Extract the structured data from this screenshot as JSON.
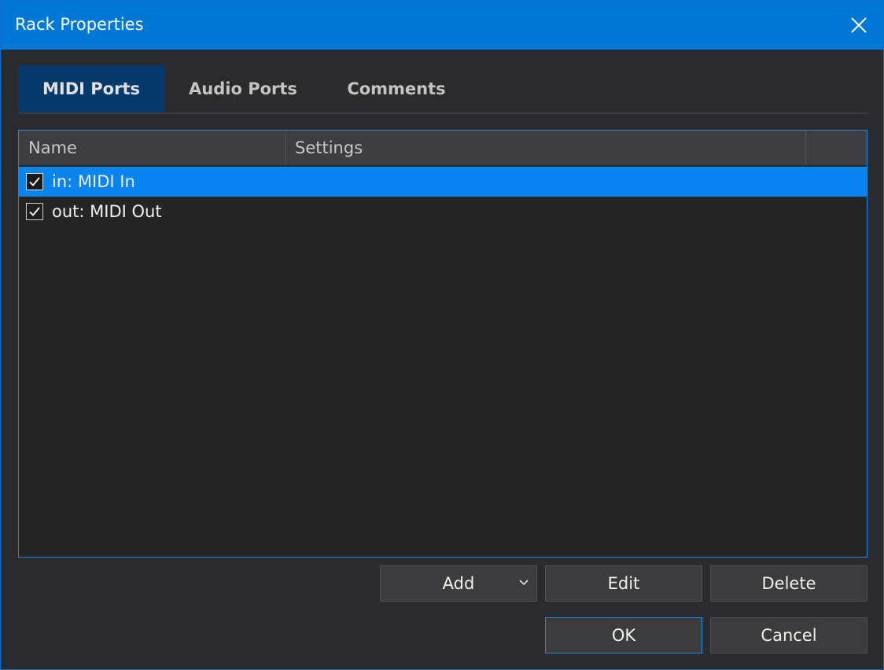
{
  "window": {
    "title": "Rack Properties"
  },
  "tabs": [
    {
      "label": "MIDI Ports",
      "active": true
    },
    {
      "label": "Audio Ports",
      "active": false
    },
    {
      "label": "Comments",
      "active": false
    }
  ],
  "list": {
    "columns": [
      "Name",
      "Settings",
      ""
    ],
    "rows": [
      {
        "label": "in: MIDI In",
        "checked": true,
        "selected": true
      },
      {
        "label": "out: MIDI Out",
        "checked": true,
        "selected": false
      }
    ]
  },
  "buttons": {
    "add": "Add",
    "edit": "Edit",
    "delete": "Delete",
    "ok": "OK",
    "cancel": "Cancel"
  },
  "icons": {
    "close": "close-icon",
    "checkmark": "checkmark-icon",
    "dropdown": "chevron-down-icon"
  },
  "colors": {
    "titlebar": "#0078d7",
    "selection": "#0a84f0",
    "active_tab": "#063a6d",
    "focus_border": "#1e88e5"
  }
}
